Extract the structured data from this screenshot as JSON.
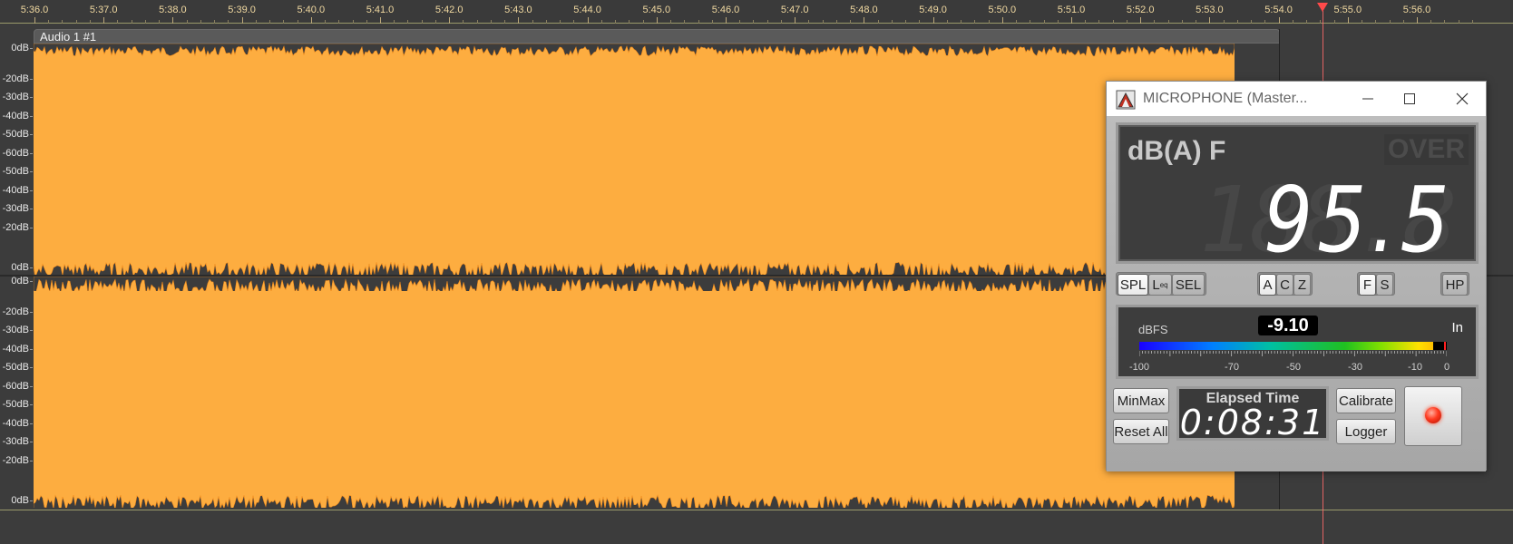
{
  "timeline": {
    "labels": [
      "5:36.0",
      "5:37.0",
      "5:38.0",
      "5:39.0",
      "5:40.0",
      "5:41.0",
      "5:42.0",
      "5:43.0",
      "5:44.0",
      "5:45.0",
      "5:46.0",
      "5:47.0",
      "5:48.0",
      "5:49.0",
      "5:50.0",
      "5:51.0",
      "5:52.0",
      "5:53.0",
      "5:54.0",
      "5:55.0",
      "5:56.0"
    ]
  },
  "track": {
    "clip_title": "Audio 1 #1",
    "channel1_db_labels": [
      "0dB",
      "-20dB",
      "-30dB",
      "-40dB",
      "-50dB",
      "-60dB",
      "-50dB",
      "-40dB",
      "-30dB",
      "-20dB",
      "0dB"
    ],
    "channel2_db_labels": [
      "0dB",
      "-20dB",
      "-30dB",
      "-40dB",
      "-50dB",
      "-60dB",
      "-50dB",
      "-40dB",
      "-30dB",
      "-20dB",
      "0dB"
    ]
  },
  "meter": {
    "window_title": "MICROPHONE (Master...",
    "weighting": "dB(A) F",
    "over_label": "OVER",
    "spl_value": "95.5",
    "spl_ghost": "188.8",
    "buttons": {
      "spl": "SPL",
      "leq": "L",
      "leq_sub": "eq",
      "sel": "SEL",
      "a": "A",
      "c": "C",
      "z": "Z",
      "f": "F",
      "s": "S",
      "hp": "HP",
      "minmax": "MinMax",
      "reset_all": "Reset All",
      "calibrate": "Calibrate",
      "logger": "Logger"
    },
    "level": {
      "unit": "dBFS",
      "value": "-9.10",
      "input_label": "In",
      "fill_fraction": 0.957,
      "scale": [
        "-100",
        "-70",
        "-50",
        "-30",
        "-10",
        "0"
      ]
    },
    "elapsed": {
      "title": "Elapsed Time",
      "value": "0:08:31"
    }
  }
}
